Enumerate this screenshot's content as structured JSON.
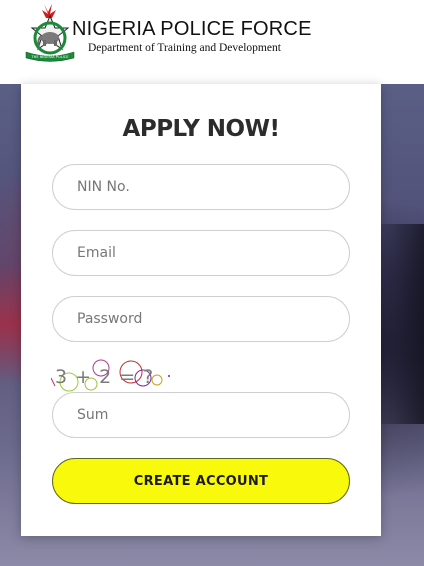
{
  "header": {
    "org_name": "NIGERIA POLICE FORCE",
    "department": "Department of Training and Development",
    "crest_motto": "THE NIGERIA POLICE"
  },
  "form": {
    "title": "APPLY NOW!",
    "nin_placeholder": "NIN No.",
    "email_placeholder": "Email",
    "password_placeholder": "Password",
    "captcha_challenge": "3 + 2 = ?",
    "sum_placeholder": "Sum",
    "submit_label": "CREATE ACCOUNT"
  },
  "colors": {
    "button_yellow": "#f9f90c",
    "title_text": "#2c2c2c",
    "crest_red": "#d11a1a",
    "crest_green": "#1a8a3a"
  }
}
